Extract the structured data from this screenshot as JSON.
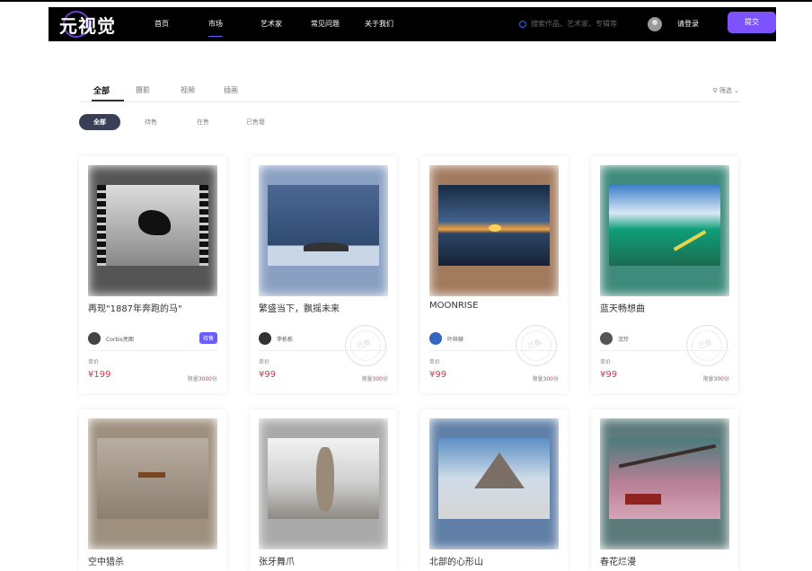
{
  "nav": {
    "logo": "元视觉",
    "items": [
      "首页",
      "市场",
      "艺术家",
      "常见问题",
      "关于我们"
    ],
    "search_placeholder": "搜索作品、艺术家、专辑等",
    "login": "请登录",
    "submit": "提交"
  },
  "tabs": [
    "全部",
    "摄影",
    "视频",
    "插画"
  ],
  "filter": "筛选",
  "chips": [
    "全部",
    "待售",
    "在售",
    "已售罄"
  ],
  "cards": [
    {
      "title": "再现\"1887年奔跑的马\"",
      "author": "Corbis亮图",
      "badge": "待售",
      "price_label": "单价",
      "price": "¥199",
      "limit_prefix": "限量",
      "limit_num": "3000",
      "limit_unit": "份"
    },
    {
      "title": "繁盛当下，飘摇未来",
      "author": "李栋栋",
      "stamp": "已售",
      "price_label": "单价",
      "price": "¥99",
      "limit_prefix": "限量",
      "limit_num": "300",
      "limit_unit": "份"
    },
    {
      "title": "MOONRISE",
      "author": "叶梓赫",
      "stamp": "已售",
      "price_label": "单价",
      "price": "¥99",
      "limit_prefix": "限量",
      "limit_num": "300",
      "limit_unit": "份"
    },
    {
      "title": "蓝天畅想曲",
      "author": "沈玲",
      "stamp": "已售",
      "price_label": "单价",
      "price": "¥99",
      "limit_prefix": "限量",
      "limit_num": "300",
      "limit_unit": "份"
    },
    {
      "title": "空中猎杀"
    },
    {
      "title": "张牙舞爪"
    },
    {
      "title": "北部的心形山"
    },
    {
      "title": "春花烂漫"
    }
  ],
  "colors": {
    "accent": "#7d52ff",
    "price": "#e0314c",
    "chip_active": "#3a3f55"
  }
}
